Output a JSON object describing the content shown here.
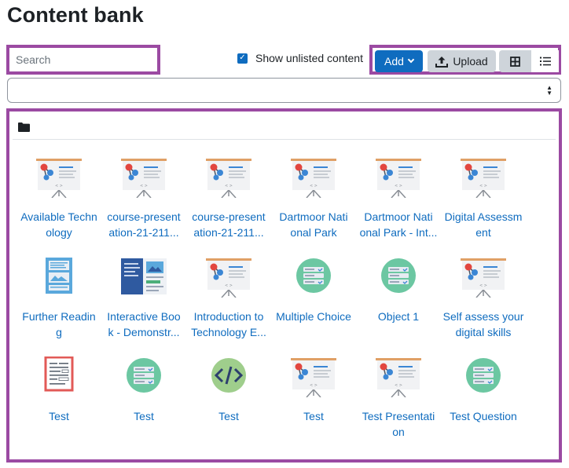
{
  "page": {
    "title": "Content bank"
  },
  "search": {
    "placeholder": "Search"
  },
  "toolbar": {
    "show_unlisted_label": "Show unlisted content",
    "show_unlisted_checked": true,
    "add_label": "Add",
    "upload_label": "Upload",
    "grid_view_icon": "grid-icon",
    "list_view_icon": "list-icon",
    "accent_color": "#0f6cbf"
  },
  "context_select": {
    "value": ""
  },
  "breadcrumb": {
    "icon": "folder-icon"
  },
  "items": [
    {
      "name": "Available Technology",
      "display": "Available Techn\nology",
      "icon": "presentation-icon"
    },
    {
      "name": "course-presentation-21-211...",
      "display": "course-present\nation-21-211...",
      "icon": "presentation-icon"
    },
    {
      "name": "course-presentation-21-211...",
      "display": "course-present\nation-21-211...",
      "icon": "presentation-icon"
    },
    {
      "name": "Dartmoor National Park",
      "display": "Dartmoor Nati\nonal Park",
      "icon": "presentation-icon"
    },
    {
      "name": "Dartmoor National Park - Int...",
      "display": "Dartmoor Nati\nonal Park - Int...",
      "icon": "presentation-icon"
    },
    {
      "name": "Digital Assessment",
      "display": "Digital Assessm\nent",
      "icon": "presentation-icon"
    },
    {
      "name": "Further Reading",
      "display": "Further Readin\ng",
      "icon": "column-icon"
    },
    {
      "name": "Interactive Book - Demonstr...",
      "display": "Interactive Boo\nk - Demonstr...",
      "icon": "interactive-book-icon"
    },
    {
      "name": "Introduction to Technology E...",
      "display": "Introduction to\nTechnology E...",
      "icon": "presentation-icon"
    },
    {
      "name": "Multiple Choice",
      "display": "Multiple Choice",
      "icon": "question-icon"
    },
    {
      "name": "Object 1",
      "display": "Object 1",
      "icon": "question-icon"
    },
    {
      "name": "Self assess your digital skills",
      "display": "Self assess your\ndigital skills",
      "icon": "presentation-icon"
    },
    {
      "name": "Test",
      "display": "Test",
      "icon": "document-icon"
    },
    {
      "name": "Test",
      "display": "Test",
      "icon": "question-icon"
    },
    {
      "name": "Test",
      "display": "Test",
      "icon": "code-icon"
    },
    {
      "name": "Test",
      "display": "Test",
      "icon": "presentation-icon"
    },
    {
      "name": "Test Presentation",
      "display": "Test Presentati\non",
      "icon": "presentation-icon"
    },
    {
      "name": "Test Question",
      "display": "Test Question",
      "icon": "question-icon"
    }
  ]
}
